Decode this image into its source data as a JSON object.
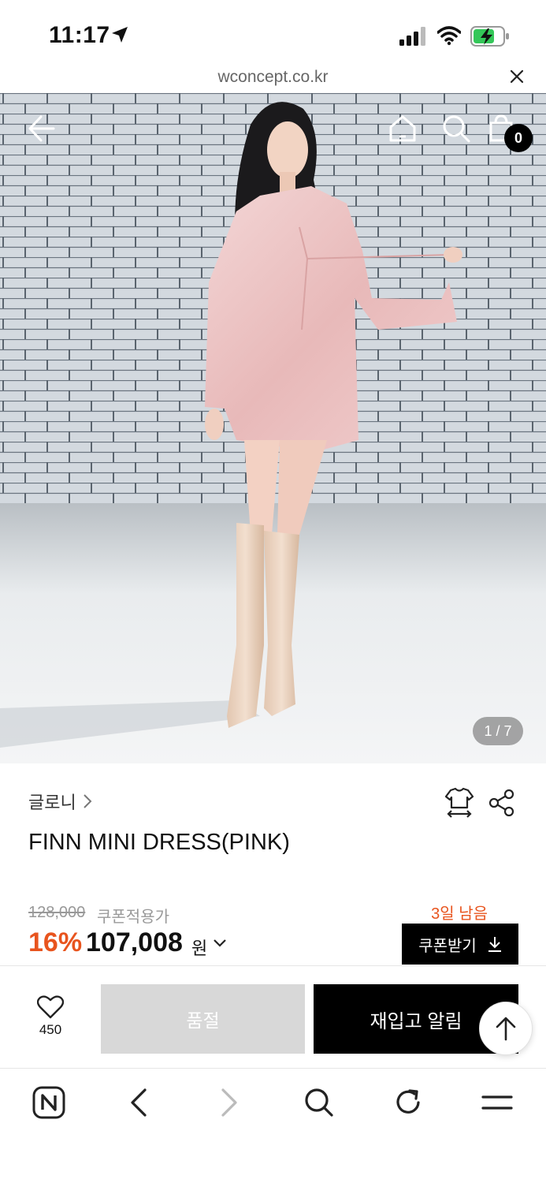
{
  "status": {
    "time": "11:17"
  },
  "browser": {
    "url": "wconcept.co.kr"
  },
  "hero": {
    "cart_count": "0",
    "page_indicator": "1 / 7"
  },
  "product": {
    "brand": "글로니",
    "title": "FINN MINI DRESS(PINK)",
    "original_price": "128,000",
    "coupon_label": "쿠폰적용가",
    "days_left": "3일 남음",
    "discount": "16%",
    "sale_price": "107,008",
    "currency": "원",
    "coupon_button": "쿠폰받기"
  },
  "actions": {
    "like_count": "450",
    "soldout_label": "품절",
    "restock_label": "재입고 알림"
  },
  "colors": {
    "accent": "#e8541e",
    "dark": "#000000",
    "disabled": "#d8d8d8"
  },
  "icons": [
    "back-arrow-icon",
    "home-icon",
    "search-icon",
    "shopping-bag-icon",
    "fit-guide-icon",
    "share-icon",
    "heart-icon",
    "arrow-up-icon",
    "naver-icon",
    "chevron-left-icon",
    "chevron-right-icon",
    "refresh-icon",
    "menu-icon"
  ]
}
